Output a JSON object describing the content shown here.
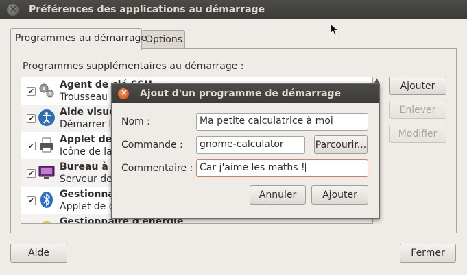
{
  "window": {
    "title": "Préférences des applications au démarrage"
  },
  "tabs": [
    {
      "label": "Programmes au démarrage"
    },
    {
      "label": "Options"
    }
  ],
  "panel": {
    "label": "Programmes supplémentaires au démarrage :"
  },
  "startup_list": [
    {
      "title": "Agent de clé SSH",
      "subtitle": "Trousseau d",
      "icon": "gears-icon",
      "checked": true
    },
    {
      "title": "Aide visue",
      "subtitle": "Démarrer l'",
      "icon": "accessibility-icon",
      "checked": true
    },
    {
      "title": "Applet de",
      "subtitle": "Icône de la",
      "icon": "printer-icon",
      "checked": true
    },
    {
      "title": "Bureau à d",
      "subtitle": "Serveur de",
      "icon": "remote-desktop-icon",
      "checked": true
    },
    {
      "title": "Gestionna",
      "subtitle": "Applet de g",
      "icon": "bluetooth-icon",
      "checked": true
    },
    {
      "title": "Gestionnaire d'énergie",
      "subtitle": "",
      "icon": "power-icon",
      "checked": true
    }
  ],
  "side_buttons": {
    "add": "Ajouter",
    "remove": "Enlever",
    "edit": "Modifier"
  },
  "footer": {
    "help": "Aide",
    "close": "Fermer"
  },
  "dialog": {
    "title": "Ajout d'un programme de démarrage",
    "name_label": "Nom :",
    "name_value": "Ma petite calculatrice à moi",
    "command_label": "Commande :",
    "command_value": "gnome-calculator",
    "browse": "Parcourir...",
    "comment_label": "Commentaire :",
    "comment_value": "Car j'aime les maths !",
    "cancel": "Annuler",
    "add": "Ajouter"
  },
  "colors": {
    "titlebar": "#3c3b37",
    "close_active": "#d64f17",
    "background": "#efebe7"
  }
}
